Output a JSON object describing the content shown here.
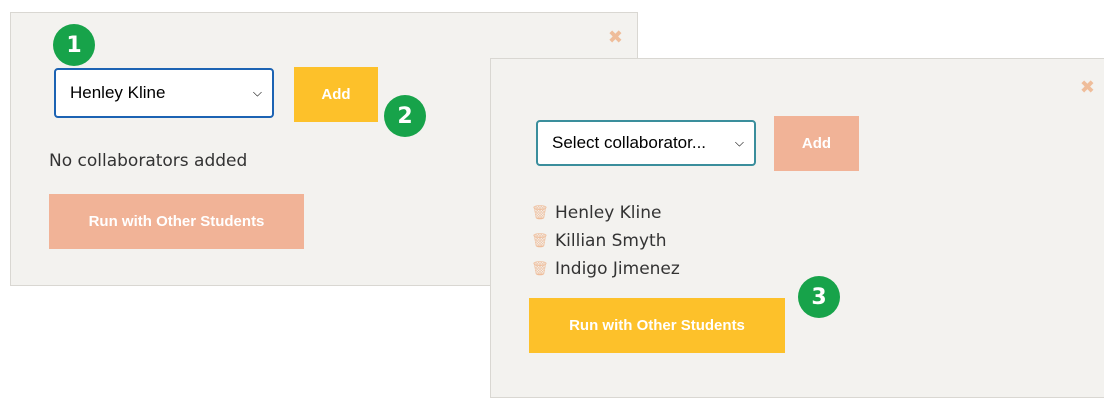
{
  "panel_1": {
    "close_label": "✖",
    "select_value": "Henley Kline",
    "add_label": "Add",
    "empty_message": "No collaborators added",
    "run_label": "Run with Other Students"
  },
  "panel_2": {
    "close_label": "✖",
    "select_value": "Select collaborator...",
    "add_label": "Add",
    "collaborators": [
      "Henley Kline",
      "Killian Smyth",
      "Indigo Jimenez"
    ],
    "run_label": "Run with Other Students"
  },
  "badges": [
    "1",
    "2",
    "3"
  ],
  "icons": {
    "trash": "🗑",
    "chevron": "⌄"
  },
  "colors": {
    "panel_bg": "#f3f2ef",
    "yellow_button": "#fdc12a",
    "salmon_button": "#f1b397",
    "badge_green": "#17a34a",
    "select_border_focus": "#1c63b3",
    "select_border_teal": "#3a8e9c"
  }
}
